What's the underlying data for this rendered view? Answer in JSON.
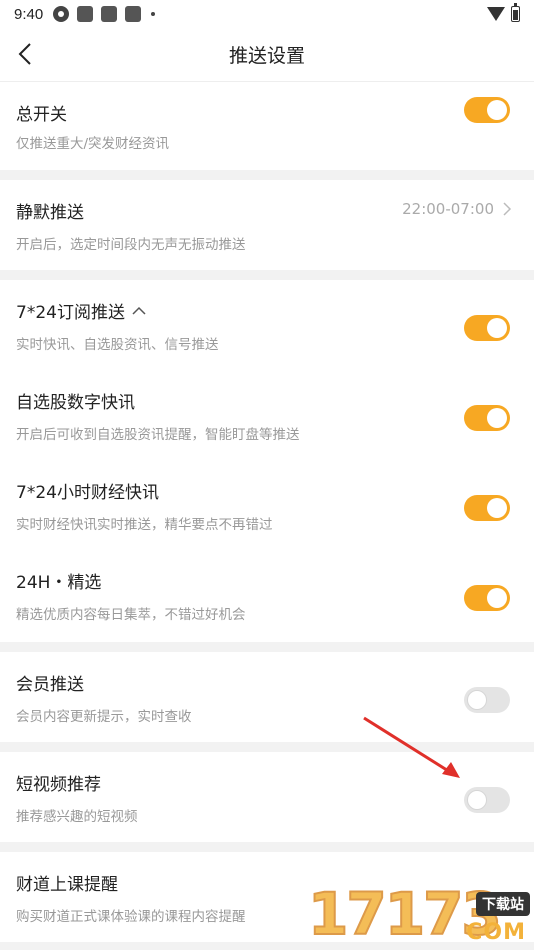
{
  "statusbar": {
    "time": "9:40"
  },
  "header": {
    "title": "推送设置"
  },
  "sections": [
    {
      "rows": [
        {
          "title": "总开关",
          "desc": "仅推送重大/突发财经资讯",
          "toggle": "on"
        }
      ]
    },
    {
      "rows": [
        {
          "title": "静默推送",
          "desc": "开启后，选定时间段内无声无振动推送",
          "value": "22:00-07:00"
        }
      ]
    },
    {
      "rows": [
        {
          "title": "7*24订阅推送",
          "desc": "实时快讯、自选股资讯、信号推送",
          "toggle": "on"
        },
        {
          "title": "自选股数字快讯",
          "desc": "开启后可收到自选股资讯提醒，智能盯盘等推送",
          "toggle": "on"
        },
        {
          "title": "7*24小时财经快讯",
          "desc": "实时财经快讯实时推送，精华要点不再错过",
          "toggle": "on"
        },
        {
          "title": "24H・精选",
          "desc": "精选优质内容每日集萃，不错过好机会",
          "toggle": "on"
        }
      ]
    },
    {
      "rows": [
        {
          "title": "会员推送",
          "desc": "会员内容更新提示，实时查收",
          "toggle": "off"
        }
      ]
    },
    {
      "rows": [
        {
          "title": "短视频推荐",
          "desc": "推荐感兴趣的短视频",
          "toggle": "off"
        }
      ]
    },
    {
      "rows": [
        {
          "title": "财道上课提醒",
          "desc": "购买财道正式课体验课的课程内容提醒"
        }
      ]
    }
  ],
  "watermark": {
    "number": "17173",
    "badge": "下载站",
    "domain": "COM"
  },
  "colors": {
    "accent": "#f7a823",
    "toggle_off": "#e4e4e4",
    "annotation_arrow": "#e0302a"
  }
}
